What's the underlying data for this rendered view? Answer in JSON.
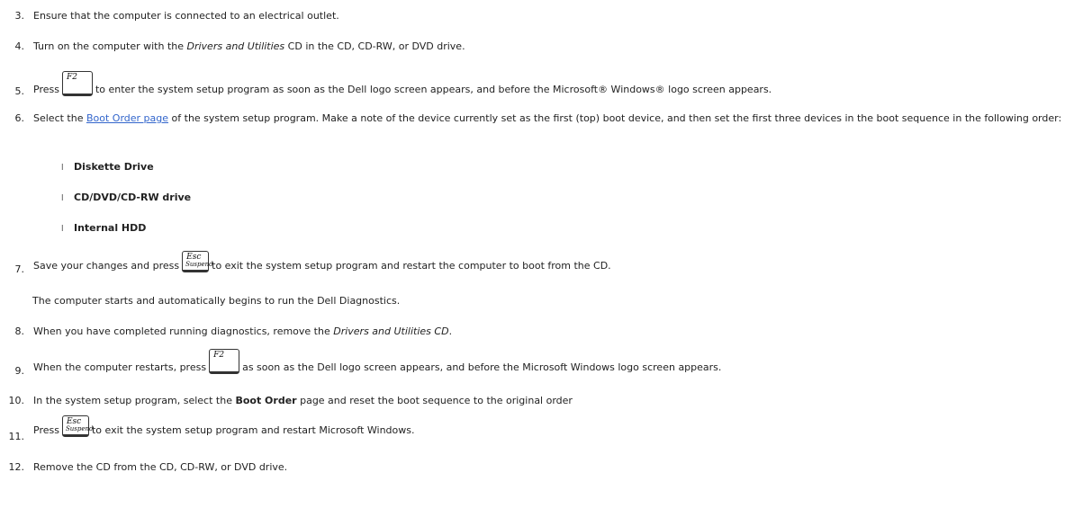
{
  "steps": [
    {
      "num": "3.",
      "text": "Ensure that the computer is connected to an electrical outlet."
    },
    {
      "num": "4.",
      "pre": "Turn on the computer with the ",
      "em": "Drivers and Utilities",
      "post": " CD in the CD, CD-RW, or DVD drive."
    },
    {
      "num": "5.",
      "pre": "Press",
      "key": "F2",
      "post": "to enter the system setup program as soon as the Dell logo screen appears, and before the Microsoft® Windows® logo screen appears."
    },
    {
      "num": "6.",
      "pre": "Select the ",
      "link": "Boot Order page",
      "post": " of the system setup program. Make a note of the device currently set as the first (top) boot device, and then set the first three devices in the boot sequence in the following order:"
    },
    {
      "num": "7.",
      "pre": "Save your changes and press",
      "key_top": "Esc",
      "key_bottom": "Suspend",
      "post": "to exit the system setup program and restart the computer to boot from the CD."
    },
    {
      "note": "The computer starts and automatically begins to run the Dell Diagnostics."
    },
    {
      "num": "8.",
      "pre": "When you have completed running diagnostics, remove the ",
      "em": "Drivers and Utilities CD",
      "post": "."
    },
    {
      "num": "9.",
      "pre": "When the computer restarts, press",
      "key": "F2",
      "post": "as soon as the Dell logo screen appears, and before the Microsoft Windows logo screen appears."
    },
    {
      "num": "10.",
      "pre": "In the system setup program, select the ",
      "bold": "Boot Order",
      "post": " page and reset the boot sequence to the original order"
    },
    {
      "num": "11.",
      "pre": "Press",
      "key_top": "Esc",
      "key_bottom": "Suspend",
      "post": "to exit the system setup program and restart Microsoft Windows."
    },
    {
      "num": "12.",
      "text": "Remove the CD from the CD, CD-RW, or DVD drive."
    }
  ],
  "boot_devices": [
    {
      "bullet": "l",
      "label": "Diskette Drive"
    },
    {
      "bullet": "l",
      "label": "CD/DVD/CD-RW drive"
    },
    {
      "bullet": "l",
      "label": "Internal HDD"
    }
  ]
}
